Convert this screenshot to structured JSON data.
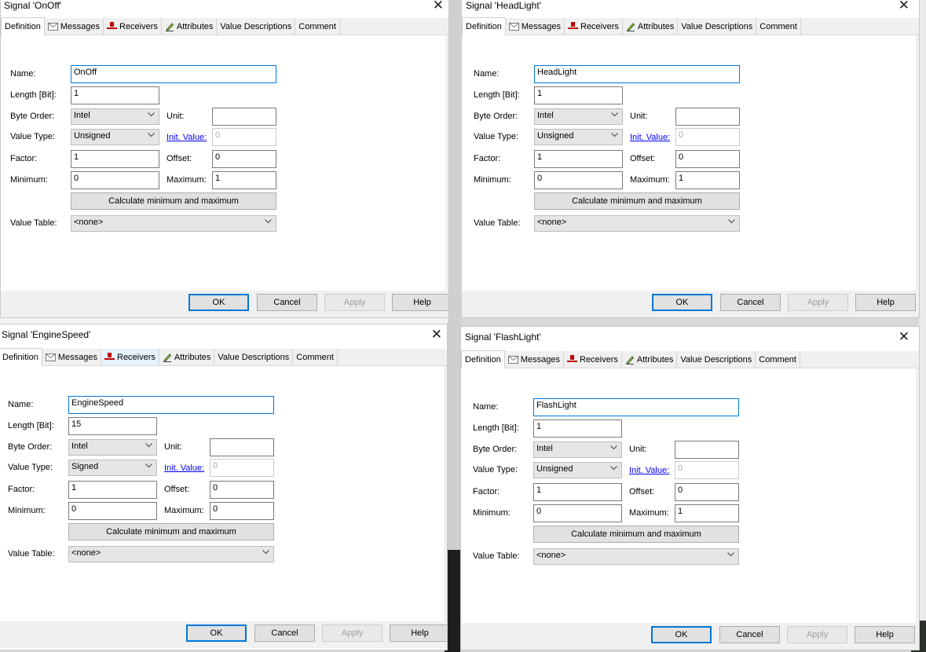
{
  "tabs": {
    "definition": "Definition",
    "messages": "Messages",
    "receivers": "Receivers",
    "attributes": "Attributes",
    "value_descriptions": "Value Descriptions",
    "comment": "Comment"
  },
  "labels": {
    "name": "Name:",
    "length": "Length [Bit]:",
    "byte_order": "Byte Order:",
    "unit": "Unit:",
    "value_type": "Value Type:",
    "init_value": "Init. Value:",
    "factor": "Factor:",
    "offset": "Offset:",
    "minimum": "Minimum:",
    "maximum": "Maximum:",
    "calc": "Calculate minimum and maximum",
    "value_table": "Value Table:"
  },
  "buttons": {
    "ok": "OK",
    "cancel": "Cancel",
    "apply": "Apply",
    "help": "Help"
  },
  "close_glyph": "✕",
  "dialogs": [
    {
      "title": "Signal 'OnOff'",
      "name": "OnOff",
      "length": "1",
      "byte_order": "Intel",
      "value_type": "Unsigned",
      "unit": "",
      "init_value": "0",
      "factor": "1",
      "offset": "0",
      "minimum": "0",
      "maximum": "1",
      "value_table": "<none>"
    },
    {
      "title": "Signal 'HeadLight'",
      "name": "HeadLight",
      "length": "1",
      "byte_order": "Intel",
      "value_type": "Unsigned",
      "unit": "",
      "init_value": "0",
      "factor": "1",
      "offset": "0",
      "minimum": "0",
      "maximum": "1",
      "value_table": "<none>"
    },
    {
      "title": "Signal 'EngineSpeed'",
      "name": "EngineSpeed",
      "length": "15",
      "byte_order": "Intel",
      "value_type": "Signed",
      "unit": "",
      "init_value": "0",
      "factor": "1",
      "offset": "0",
      "minimum": "0",
      "maximum": "0",
      "value_table": "<none>"
    },
    {
      "title": "Signal 'FlashLight'",
      "name": "FlashLight",
      "length": "1",
      "byte_order": "Intel",
      "value_type": "Unsigned",
      "unit": "",
      "init_value": "0",
      "factor": "1",
      "offset": "0",
      "minimum": "0",
      "maximum": "1",
      "value_table": "<none>"
    }
  ],
  "colors": {
    "focus_border": "#0078d7",
    "link": "#0000ff",
    "receivers_icon": "#c00000"
  }
}
